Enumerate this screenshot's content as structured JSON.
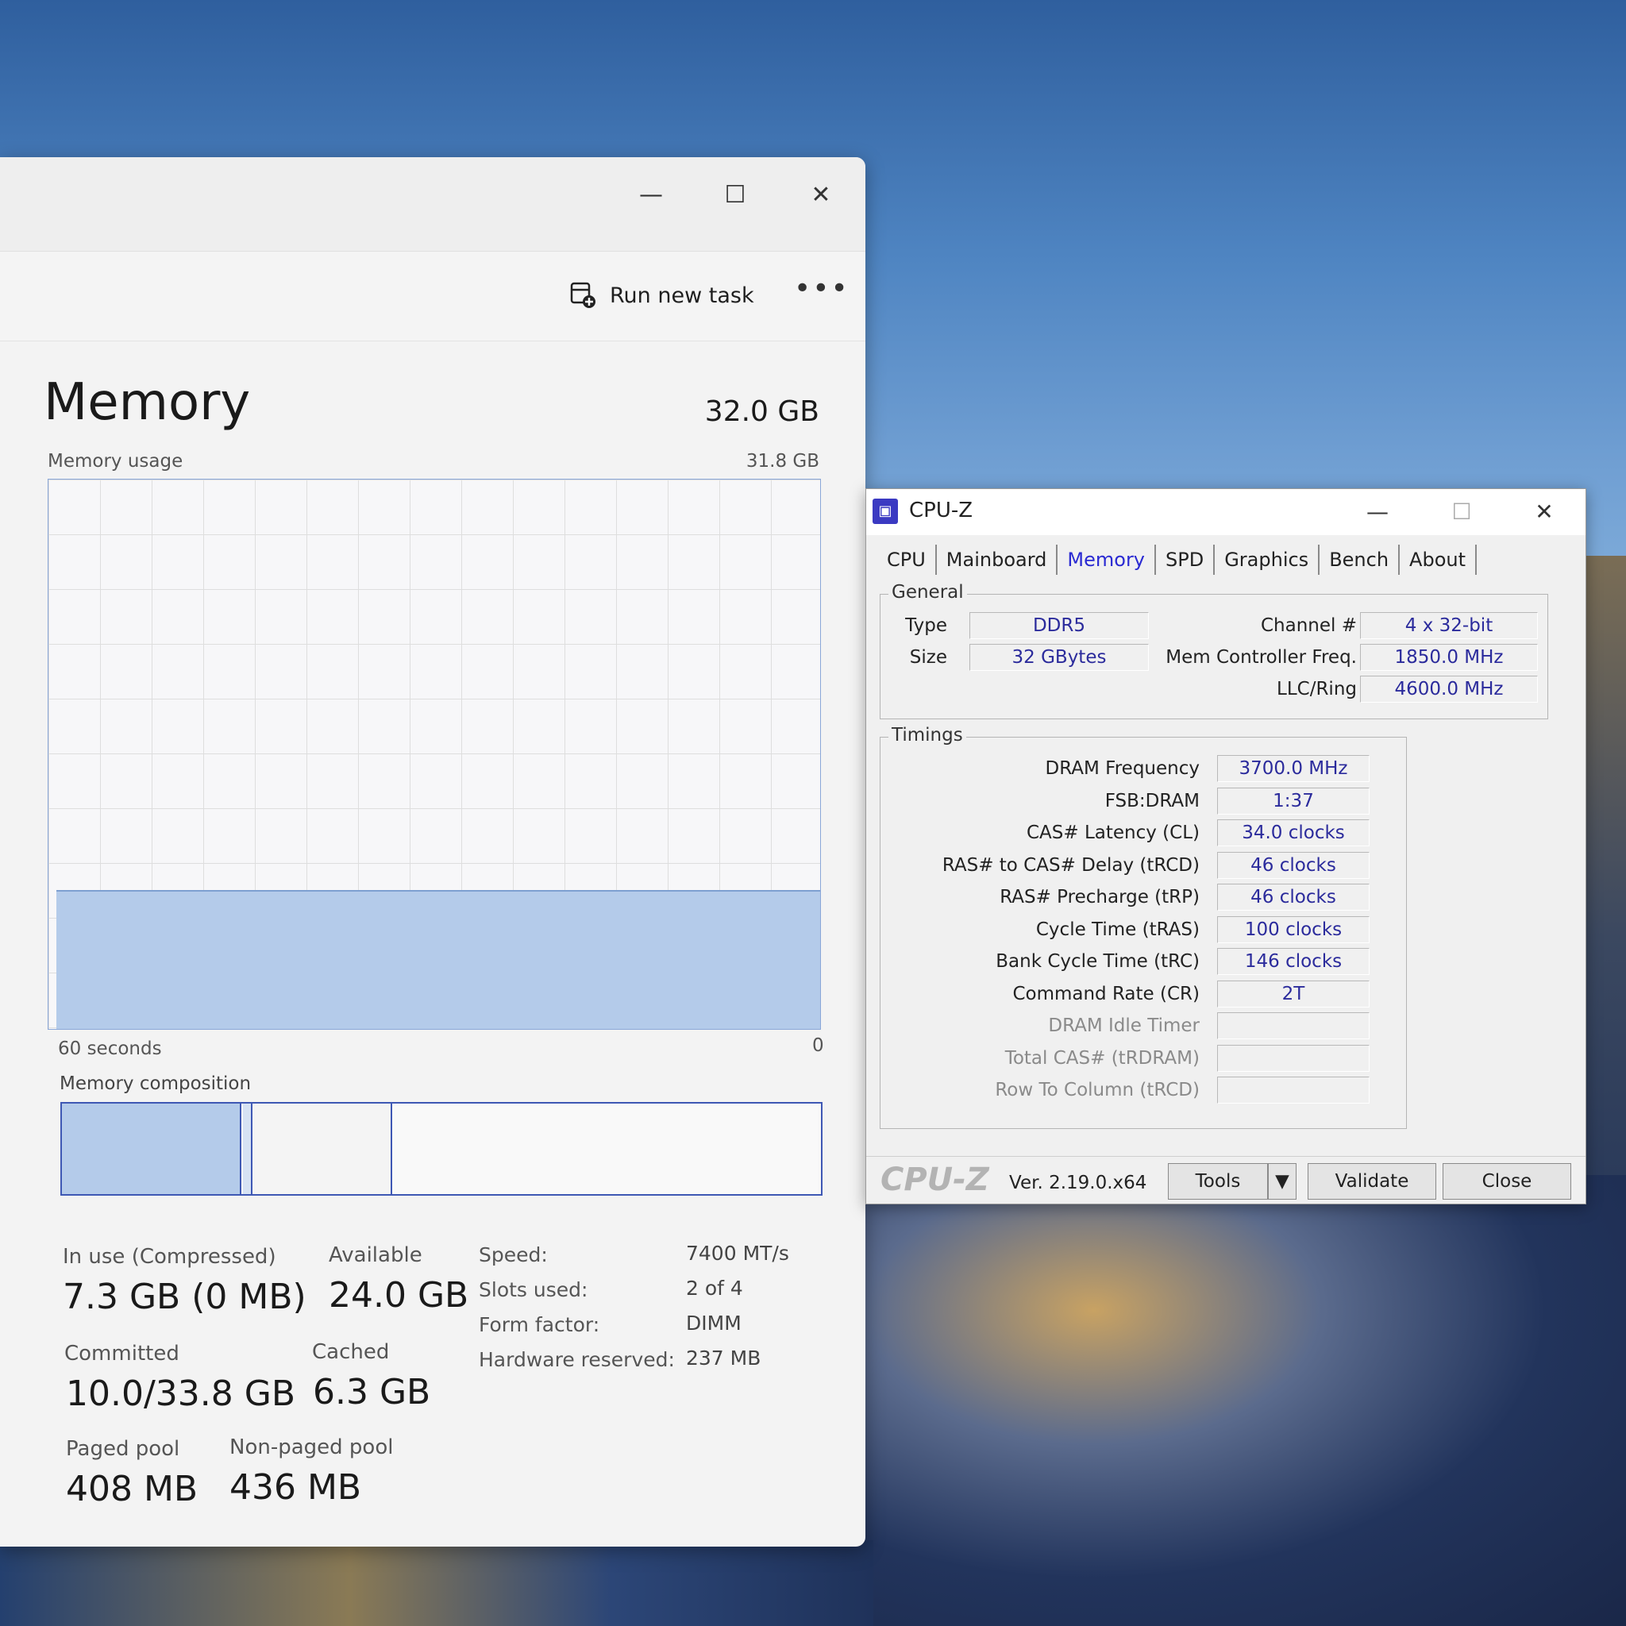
{
  "task_manager": {
    "toolbar": {
      "run_new_task": "Run new task",
      "more": "•••"
    },
    "title": "Memory",
    "total": "32.0 GB",
    "usage_label": "Memory usage",
    "usage_max": "31.8 GB",
    "graph_fill_percent": 25,
    "time_left": "60 seconds",
    "time_right": "0",
    "composition_label": "Memory composition",
    "stats": {
      "in_use_label": "In use (Compressed)",
      "in_use_value": "7.3 GB (0 MB)",
      "available_label": "Available",
      "available_value": "24.0 GB",
      "committed_label": "Committed",
      "committed_value": "10.0/33.8 GB",
      "cached_label": "Cached",
      "cached_value": "6.3 GB",
      "paged_label": "Paged pool",
      "paged_value": "408 MB",
      "nonpaged_label": "Non-paged pool",
      "nonpaged_value": "436 MB"
    },
    "specs": {
      "speed_label": "Speed:",
      "speed_value": "7400 MT/s",
      "slots_label": "Slots used:",
      "slots_value": "2 of 4",
      "form_label": "Form factor:",
      "form_value": "DIMM",
      "reserved_label": "Hardware reserved:",
      "reserved_value": "237 MB"
    }
  },
  "cpuz": {
    "title": "CPU-Z",
    "tabs": [
      "CPU",
      "Mainboard",
      "Memory",
      "SPD",
      "Graphics",
      "Bench",
      "About"
    ],
    "active_tab": "Memory",
    "general": {
      "title": "General",
      "type_label": "Type",
      "type_value": "DDR5",
      "size_label": "Size",
      "size_value": "32 GBytes",
      "channel_label": "Channel #",
      "channel_value": "4 x 32-bit",
      "mcf_label": "Mem Controller Freq.",
      "mcf_value": "1850.0 MHz",
      "llc_label": "LLC/Ring",
      "llc_value": "4600.0 MHz"
    },
    "timings": {
      "title": "Timings",
      "rows": [
        {
          "label": "DRAM Frequency",
          "value": "3700.0 MHz"
        },
        {
          "label": "FSB:DRAM",
          "value": "1:37"
        },
        {
          "label": "CAS# Latency (CL)",
          "value": "34.0 clocks"
        },
        {
          "label": "RAS# to CAS# Delay (tRCD)",
          "value": "46 clocks"
        },
        {
          "label": "RAS# Precharge (tRP)",
          "value": "46 clocks"
        },
        {
          "label": "Cycle Time (tRAS)",
          "value": "100 clocks"
        },
        {
          "label": "Bank Cycle Time (tRC)",
          "value": "146 clocks"
        },
        {
          "label": "Command Rate (CR)",
          "value": "2T"
        },
        {
          "label": "DRAM Idle Timer",
          "value": ""
        },
        {
          "label": "Total CAS# (tRDRAM)",
          "value": ""
        },
        {
          "label": "Row To Column (tRCD)",
          "value": ""
        }
      ]
    },
    "footer": {
      "brand": "CPU-Z",
      "version": "Ver. 2.19.0.x64",
      "tools": "Tools",
      "validate": "Validate",
      "close": "Close"
    }
  },
  "colors": {
    "graph_fill": "#b4cbea",
    "accent": "#3e58b4",
    "cpuz_value": "#2b2b9c"
  }
}
